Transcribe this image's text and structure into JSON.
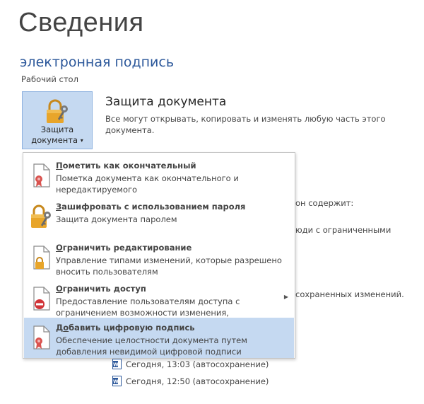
{
  "page": {
    "title": "Сведения",
    "doc_name": "электронная подпись",
    "location": "Рабочий стол"
  },
  "protect_button": {
    "line1": "Защита",
    "line2": "документа",
    "caret": "▾"
  },
  "protection_section": {
    "heading": "Защита документа",
    "description": "Все могут открывать, копировать и изменять любую часть этого документа."
  },
  "background_fragments": {
    "inspect_text": "он содержит:",
    "people_text": "юди с ограниченными",
    "unsaved_text": "сохраненных изменений."
  },
  "menu": {
    "items": [
      {
        "title_before": "",
        "title_underlined": "П",
        "title_after": "ометить как окончательный",
        "description": "Пометка документа как окончательного и нередактируемого",
        "icon": "document-ribbon-icon"
      },
      {
        "title_before": "",
        "title_underlined": "З",
        "title_after": "ашифровать с использованием пароля",
        "description": "Защита документа паролем",
        "icon": "lock-key-icon"
      },
      {
        "title_before": "",
        "title_underlined": "О",
        "title_after": "граничить редактирование",
        "description": "Управление типами изменений, которые разрешено вносить пользователям",
        "icon": "document-lock-icon"
      },
      {
        "title_before": "",
        "title_underlined": "О",
        "title_after": "граничить доступ",
        "description": "Предоставление пользователям доступа с ограничением возможности изменения, копирования и печати",
        "icon": "document-restricted-icon",
        "submenu_arrow": "▶"
      },
      {
        "title_before": "Д",
        "title_underlined": "о",
        "title_after": "бавить цифровую подпись",
        "description": "Обеспечение целостности документа путем добавления невидимой цифровой подписи",
        "icon": "document-signature-icon"
      }
    ]
  },
  "versions": [
    {
      "label": "Сегодня, 13:03 (автосохранение)",
      "icon": "word-document-icon"
    },
    {
      "label": "Сегодня, 12:50 (автосохранение)",
      "icon": "word-document-icon"
    }
  ],
  "colors": {
    "accent": "#2b579a",
    "selected_bg": "#c5d9f1",
    "lock_gold": "#e8a52a",
    "ribbon_red": "#d9534f"
  }
}
